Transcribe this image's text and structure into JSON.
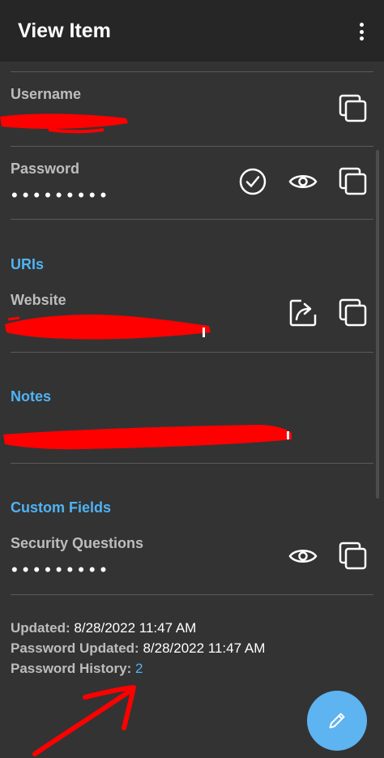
{
  "appbar": {
    "title": "View Item"
  },
  "login": {
    "username_label": "Username",
    "password_label": "Password",
    "password_masked": "•••••••••"
  },
  "uris": {
    "section_title": "URIs",
    "website_label": "Website"
  },
  "notes": {
    "section_title": "Notes"
  },
  "custom_fields": {
    "section_title": "Custom Fields",
    "field_label": "Security Questions",
    "field_masked": "•••••••••"
  },
  "meta": {
    "updated_label": "Updated:",
    "updated_value": "8/28/2022 11:47 AM",
    "password_updated_label": "Password Updated:",
    "password_updated_value": "8/28/2022 11:47 AM",
    "password_history_label": "Password History:",
    "password_history_value": "2"
  },
  "colors": {
    "background": "#333333",
    "appbar": "#262626",
    "accent": "#4fb3f3",
    "fab": "#5eb3f1",
    "redaction": "#ff0000"
  },
  "icons": {
    "menu": "more-vert-icon",
    "copy": "copy-icon",
    "check": "check-circle-icon",
    "view": "eye-icon",
    "launch": "launch-icon",
    "edit": "pencil-icon"
  }
}
